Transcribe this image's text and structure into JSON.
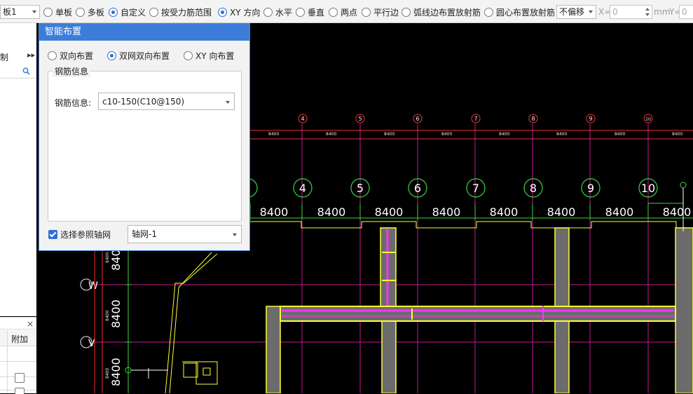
{
  "toolbar": {
    "slab_select": "板1",
    "modes": [
      "单板",
      "多板",
      "自定义",
      "按受力筋范围",
      "XY 方向",
      "水平",
      "垂直",
      "两点",
      "平行边",
      "弧线边布置放射筋",
      "圆心布置放射筋"
    ],
    "selected_modes": [
      "自定义",
      "XY 方向"
    ],
    "offset_select": "不偏移",
    "x_label": "X=",
    "x_value": "0",
    "mm_label": "mm",
    "y_label": "Y=",
    "y_value": "0"
  },
  "left_panel": {
    "row_label": "制",
    "bottom_header": "附加"
  },
  "dialog": {
    "title": "智能布置",
    "layout_options": [
      "双向布置",
      "双网双向布置",
      "XY 向布置"
    ],
    "selected_layout": "双网双向布置",
    "group_title": "钢筋信息",
    "rebar_label": "钢筋信息:",
    "rebar_value": "c10-150(C10@150)",
    "ref_axis_label": "选择参照轴网",
    "ref_axis_checked": true,
    "ref_axis_value": "轴网-1"
  },
  "cad": {
    "small_axis_numbers": [
      "4",
      "5",
      "6",
      "7",
      "8",
      "9",
      "10"
    ],
    "large_axis_numbers": [
      "4",
      "5",
      "6",
      "7",
      "8",
      "9",
      "10"
    ],
    "small_spacing_label": "8400",
    "large_spacing_label": "8400",
    "row_axis_labels": [
      "W",
      "V"
    ],
    "vertical_dim_label": "8400",
    "colors": {
      "axis_line": "#c7179a",
      "axis_bubble": "#f23030",
      "dimension": "#9ad860",
      "wall": "#ffff33",
      "rebar": "#ff33ff",
      "beam_fill": "#6b6b6b"
    }
  }
}
